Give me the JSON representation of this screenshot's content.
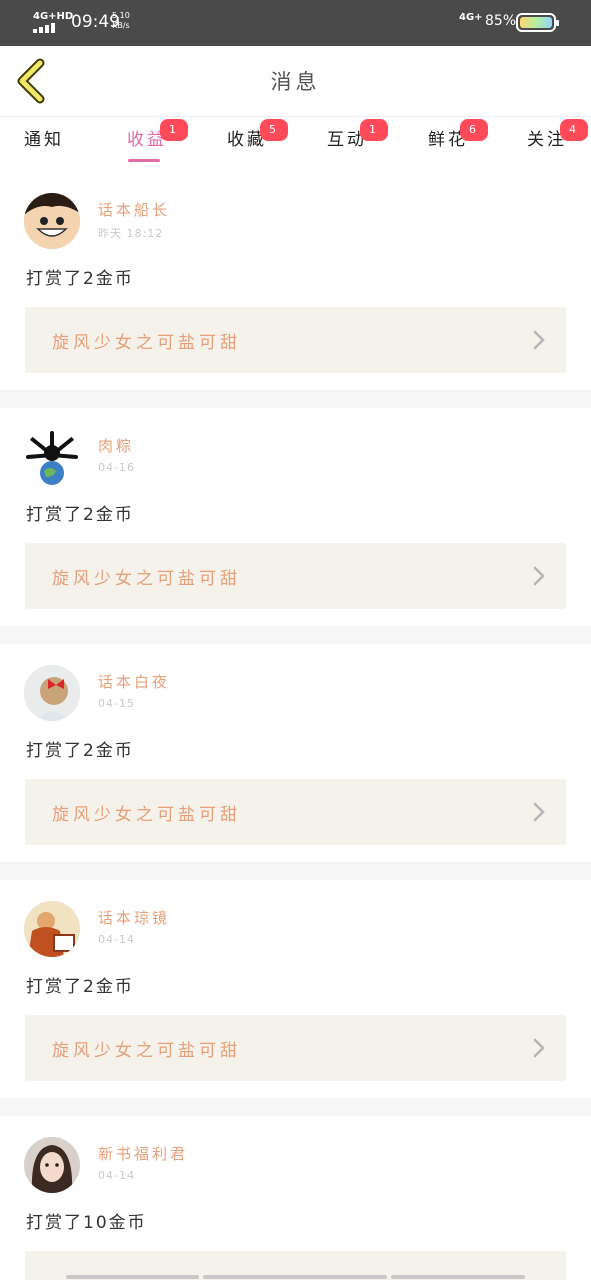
{
  "status_bar": {
    "network_left": "4G+HD",
    "time": "09:49",
    "speed_value": "5.10",
    "speed_unit": "KB/s",
    "network_right": "4G+",
    "battery": "85%"
  },
  "header": {
    "title": "消息",
    "back_icon": "chevron-left-icon"
  },
  "tabs": [
    {
      "label": "通知",
      "badge": ""
    },
    {
      "label": "收益",
      "badge": "1",
      "active": true
    },
    {
      "label": "收藏",
      "badge": "5"
    },
    {
      "label": "互动",
      "badge": "1"
    },
    {
      "label": "鲜花",
      "badge": "6"
    },
    {
      "label": "关注",
      "badge": "4"
    }
  ],
  "colors": {
    "accent_pink": "#e06ba6",
    "name_orange": "#e8a07a",
    "badge_red": "#ff4a5a",
    "book_bg": "#f4f2ea"
  },
  "feed": [
    {
      "name": "话本船长",
      "time": "昨天 18:12",
      "action": "打赏了2金币",
      "book": "旋风少女之可盐可甜",
      "avatar": "luffy-avatar"
    },
    {
      "name": "肉粽",
      "time": "04-16",
      "action": "打赏了2金币",
      "book": "旋风少女之可盐可甜",
      "avatar": "earth-avatar"
    },
    {
      "name": "话本白夜",
      "time": "04-15",
      "action": "打赏了2金币",
      "book": "旋风少女之可盐可甜",
      "avatar": "girl-bow-avatar"
    },
    {
      "name": "话本琼镜",
      "time": "04-14",
      "action": "打赏了2金币",
      "book": "旋风少女之可盐可甜",
      "avatar": "orange-avatar"
    },
    {
      "name": "新书福利君",
      "time": "04-14",
      "action": "打赏了10金币",
      "book": "",
      "avatar": "girl-avatar"
    }
  ]
}
